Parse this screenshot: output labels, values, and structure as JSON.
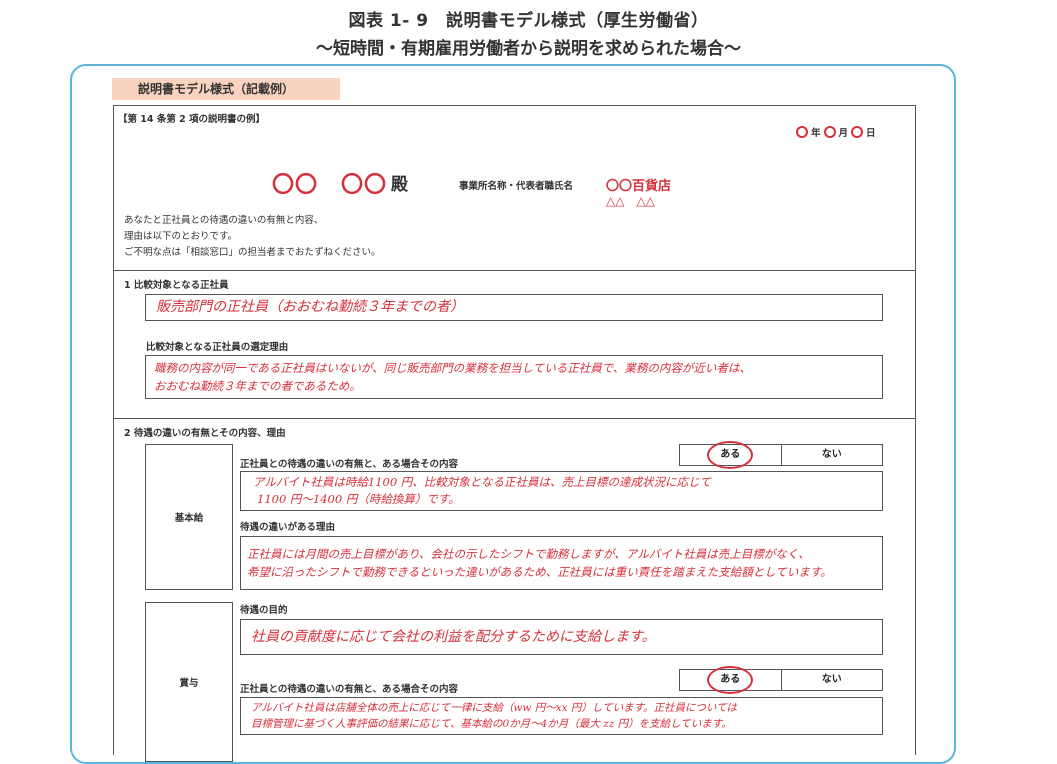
{
  "header": {
    "title": "図表 1- 9　説明書モデル様式（厚生労働省）",
    "subtitle": "～短時間・有期雇用労働者から説明を求められた場合～"
  },
  "form": {
    "badge": "説明書モデル様式（記載例）",
    "example_label": "【第 14 条第 2 項の説明書の例】",
    "date": {
      "year": "年",
      "month": "月",
      "day": "日"
    },
    "recipient_circles": "〇〇　〇〇",
    "recipient_honorific": "殿",
    "employer_label": "事業所名称・代表者職氏名",
    "employer_name": "〇〇百貨店",
    "employer_rep": "△△　△△",
    "intro_lines": [
      "あなたと正社員との待遇の違いの有無と内容、",
      "理由は以下のとおりです。",
      "ご不明な点は「相談窓口」の担当者までおたずねください。"
    ],
    "section1": {
      "heading": "1  比較対象となる正社員",
      "answer": "販売部門の正社員（おおむね勤続３年までの者）",
      "reason_label": "比較対象となる正社員の選定理由",
      "reason_lines": [
        "職務の内容が同一である正社員はいないが、同じ販売部門の業務を担当している正社員で、業務の内容が近い者は、",
        "おおむね勤続３年までの者であるため。"
      ]
    },
    "section2": {
      "heading": "2  待遇の違いの有無とその内容、理由",
      "base_pay": {
        "label": "基本給",
        "diff_label": "正社員との待遇の違いの有無と、ある場合その内容",
        "yes": "ある",
        "no": "ない",
        "diff_lines": [
          "アルバイト社員は時給1100 円、比較対象となる正社員は、売上目標の達成状況に応じて",
          "1100 円～1400 円（時給換算）です。"
        ],
        "reason_label": "待遇の違いがある理由",
        "reason_lines": [
          "正社員には月間の売上目標があり、会社の示したシフトで勤務しますが、アルバイト社員は売上目標がなく、",
          "希望に沿ったシフトで勤務できるといった違いがあるため、正社員には重い責任を踏まえた支給額としています。"
        ]
      },
      "bonus": {
        "label": "賞与",
        "purpose_label": "待遇の目的",
        "purpose_text": "社員の貢献度に応じて会社の利益を配分するために支給します。",
        "diff_label": "正社員との待遇の違いの有無と、ある場合その内容",
        "yes": "ある",
        "no": "ない",
        "diff_lines": [
          "アルバイト社員は店舗全体の売上に応じて一律に支給（ww 円～xx 円）しています。正社員については",
          "目標管理に基づく人事評価の結果に応じて、基本給の0か月～4か月（最大 zz 円）を支給しています。"
        ]
      }
    }
  }
}
